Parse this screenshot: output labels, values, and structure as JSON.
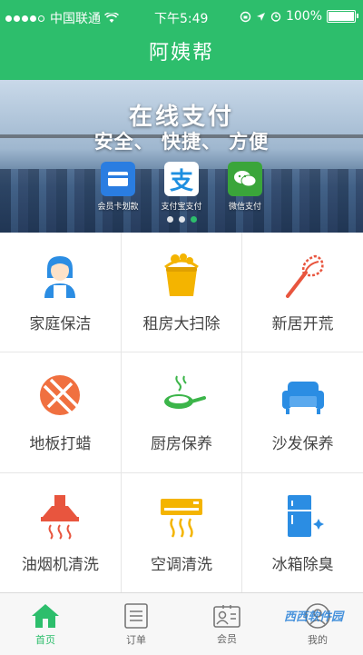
{
  "status_bar": {
    "carrier": "中国联通",
    "time": "下午5:49",
    "battery": "100%"
  },
  "navbar": {
    "title": "阿姨帮"
  },
  "banner": {
    "title": "在线支付",
    "subtitle": "安全、 快捷、 方便",
    "payments": [
      {
        "label": "会员卡划款",
        "icon": "card-icon",
        "color": "#2a7de1"
      },
      {
        "label": "支付宝支付",
        "icon": "alipay-icon",
        "color": "#1e8fe0"
      },
      {
        "label": "微信支付",
        "icon": "wechat-icon",
        "color": "#3aa53a"
      }
    ],
    "pager": {
      "count": 3,
      "active": 3
    }
  },
  "services": [
    {
      "label": "家庭保洁",
      "icon": "housekeeper-icon",
      "color": "#2b8de3"
    },
    {
      "label": "租房大扫除",
      "icon": "cleaning-bucket-icon",
      "color": "#f4b400"
    },
    {
      "label": "新居开荒",
      "icon": "feather-duster-icon",
      "color": "#e8553e"
    },
    {
      "label": "地板打蜡",
      "icon": "floor-wax-icon",
      "color": "#f07040"
    },
    {
      "label": "厨房保养",
      "icon": "frying-pan-icon",
      "color": "#3cb54a"
    },
    {
      "label": "沙发保养",
      "icon": "sofa-icon",
      "color": "#2b8de3"
    },
    {
      "label": "油烟机清洗",
      "icon": "range-hood-icon",
      "color": "#e8553e"
    },
    {
      "label": "空调清洗",
      "icon": "air-conditioner-icon",
      "color": "#f4b400"
    },
    {
      "label": "冰箱除臭",
      "icon": "fridge-icon",
      "color": "#2b8de3"
    }
  ],
  "tabs": [
    {
      "label": "首页",
      "icon": "home-icon",
      "active": true
    },
    {
      "label": "订单",
      "icon": "order-icon",
      "active": false
    },
    {
      "label": "会员",
      "icon": "member-icon",
      "active": false
    },
    {
      "label": "我的",
      "icon": "profile-icon",
      "active": false
    }
  ],
  "watermark": "西西软件园",
  "colors": {
    "brand_green": "#2dbe6c"
  }
}
